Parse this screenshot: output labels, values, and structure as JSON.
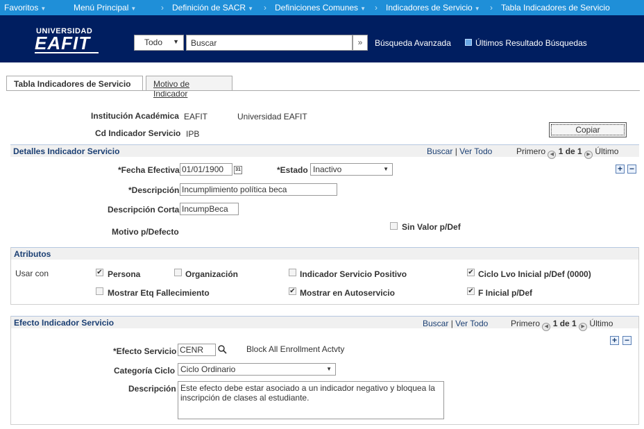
{
  "topnav": {
    "favorites": "Favoritos",
    "main_menu": "Menú Principal",
    "crumbs": [
      "Definición de SACR",
      "Definiciones Comunes",
      "Indicadores de Servicio",
      "Tabla Indicadores de Servicio"
    ]
  },
  "header": {
    "logo_top": "UNIVERSIDAD",
    "logo_main": "EAFIT",
    "scope": "Todo",
    "search_placeholder": "Buscar",
    "advanced": "Búsqueda Avanzada",
    "last_results": "Últimos Resultado Búsquedas"
  },
  "tabs": [
    {
      "label": "Tabla Indicadores de Servicio",
      "active": true
    },
    {
      "label": "Motivo de Indicador",
      "active": false
    }
  ],
  "key": {
    "institution_label": "Institución Académica",
    "institution_code": "EAFIT",
    "institution_name": "Universidad EAFIT",
    "indicator_label": "Cd Indicador Servicio",
    "indicator_code": "IPB",
    "copy_button": "Copiar"
  },
  "details": {
    "title": "Detalles Indicador Servicio",
    "find": "Buscar",
    "view_all": "Ver Todo",
    "first": "Primero",
    "range": "1 de 1",
    "last": "Último",
    "eff_date_label": "*Fecha Efectiva",
    "eff_date": "01/01/1900",
    "status_label": "*Estado",
    "status": "Inactivo",
    "desc_label": "*Descripción",
    "desc": "Incumplimiento política beca",
    "short_desc_label": "Descripción Corta",
    "short_desc": "IncumpBeca",
    "default_reason_label": "Motivo p/Defecto",
    "no_default_label": "Sin Valor p/Def"
  },
  "attributes": {
    "title": "Atributos",
    "use_with": "Usar con",
    "items": [
      {
        "label": "Persona",
        "checked": true
      },
      {
        "label": "Organización",
        "checked": false
      },
      {
        "label": "Indicador Servicio Positivo",
        "checked": false
      },
      {
        "label": "Ciclo Lvo Inicial p/Def (0000)",
        "checked": true
      },
      {
        "label": "Mostrar Etq Fallecimiento",
        "checked": false
      },
      {
        "label": "Mostrar en Autoservicio",
        "checked": true
      },
      {
        "label": "F Inicial p/Def",
        "checked": true
      }
    ]
  },
  "effect": {
    "title": "Efecto Indicador Servicio",
    "find": "Buscar",
    "view_all": "Ver Todo",
    "first": "Primero",
    "range": "1 de 1",
    "last": "Último",
    "effect_label": "*Efecto Servicio",
    "effect_code": "CENR",
    "effect_desc": "Block All Enrollment Actvty",
    "term_cat_label": "Categoría Ciclo",
    "term_cat": "Ciclo Ordinario",
    "desc_label": "Descripción",
    "desc": "Este efecto debe estar asociado a un indicador negativo y bloquea la inscripción de clases al estudiante."
  }
}
